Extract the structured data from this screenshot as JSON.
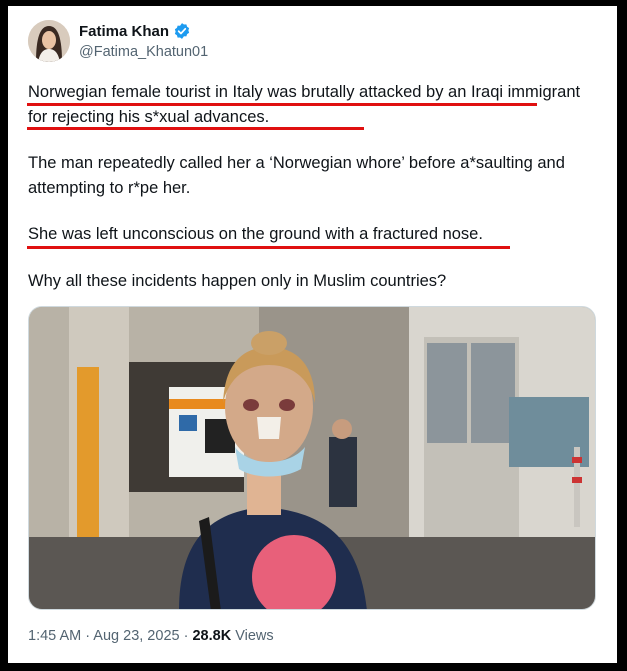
{
  "author": {
    "display_name": "Fatima Khan",
    "handle": "@Fatima_Khatun01",
    "verified_icon": "verified-badge-icon",
    "verified_color": "#1d9bf0"
  },
  "tweet": {
    "paragraphs": [
      "Norwegian female tourist in Italy was brutally attacked by an Iraqi immigrant for rejecting his s*xual advances.",
      "The man repeatedly called her a ‘Norwegian whore’ before a*saulting and attempting to r*pe her.",
      "She was left unconscious on the ground with a fractured nose.",
      "Why all these incidents happen only in Muslim countries?"
    ],
    "highlight_color": "#e01010"
  },
  "footer": {
    "time": "1:45 AM",
    "separator": " · ",
    "date": "Aug 23, 2025",
    "views_count": "28.8K",
    "views_label": "Views"
  }
}
